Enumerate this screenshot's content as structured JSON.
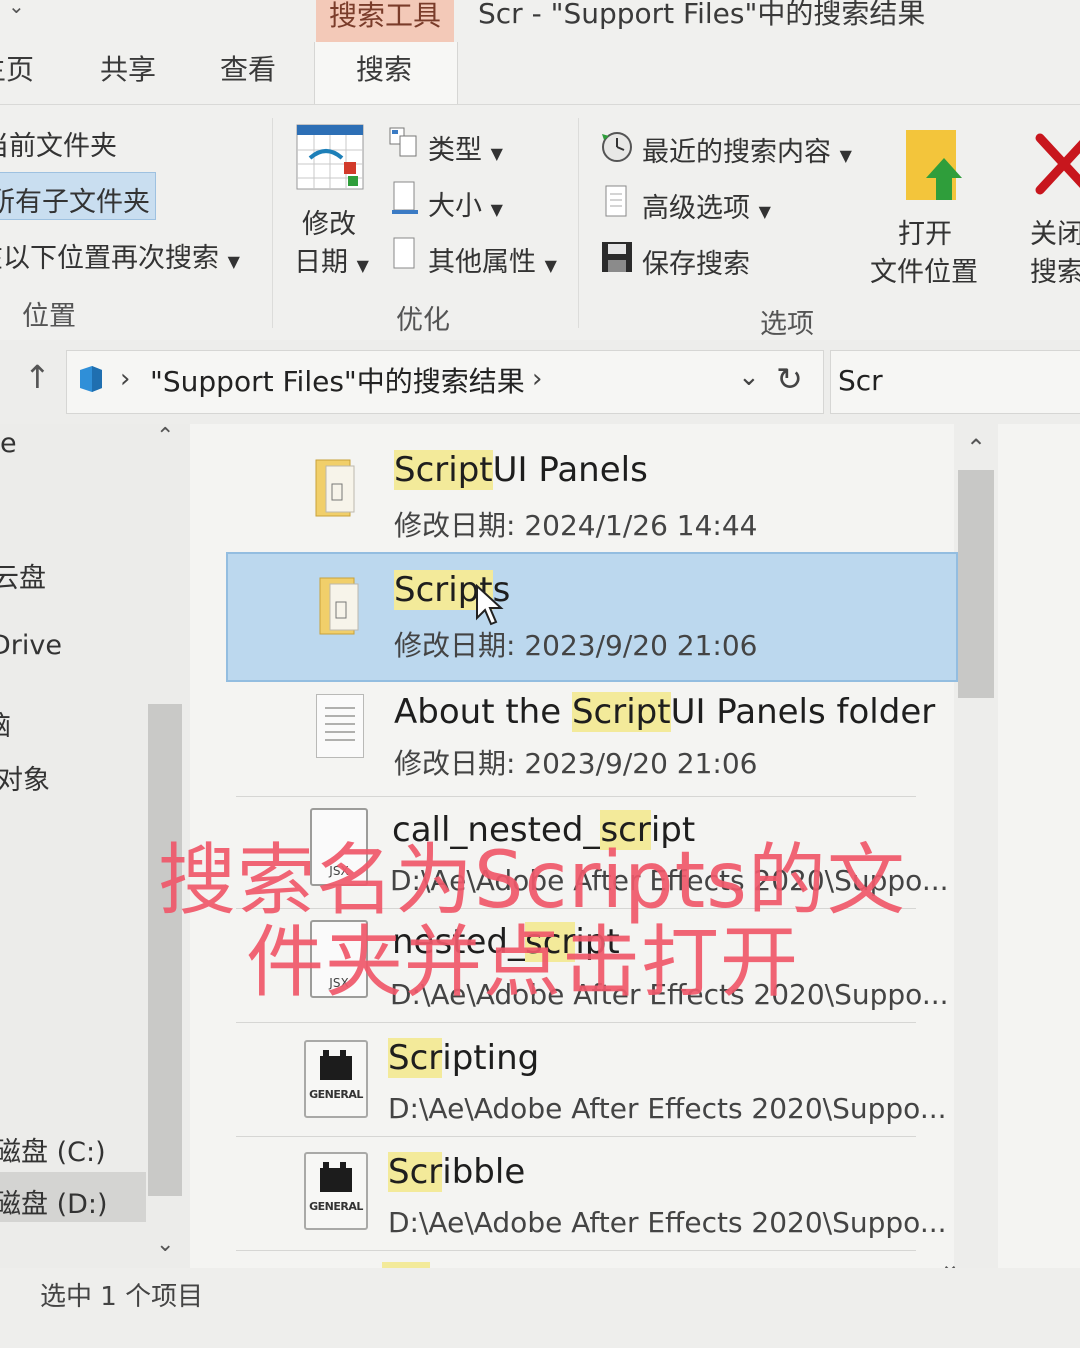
{
  "window": {
    "contextual_tab": "搜索工具",
    "title": "Scr - \"Support Files\"中的搜索结果"
  },
  "tabs": [
    "主页",
    "共享",
    "查看",
    "搜索"
  ],
  "ribbon": {
    "location": {
      "current_folder": "当前文件夹",
      "all_subfolders": "所有子文件夹",
      "search_again": "在以下位置再次搜索",
      "label": "位置"
    },
    "refine": {
      "date_modified_line1": "修改",
      "date_modified_line2": "日期",
      "kind": "类型",
      "size": "大小",
      "other_properties": "其他属性",
      "label": "优化"
    },
    "options": {
      "recent_searches": "最近的搜索内容",
      "advanced_options": "高级选项",
      "save_search": "保存搜索",
      "open_location_line1": "打开",
      "open_location_line2": "文件位置",
      "close_search_line1": "关闭",
      "close_search_line2": "搜索",
      "label": "选项"
    }
  },
  "address": {
    "path": "\"Support Files\"中的搜索结果",
    "search_query": "Scr"
  },
  "nav": {
    "items": [
      "e",
      "云盘",
      "Drive",
      "脑",
      "对象",
      "磁盘 (C:)",
      "磁盘 (D:)"
    ]
  },
  "results": [
    {
      "name_pre": "",
      "name_hl": "Script",
      "name_post": "UI Panels",
      "meta": "修改日期: 2024/1/26 14:44",
      "icon": "folder-icon"
    },
    {
      "name_pre": "",
      "name_hl": "Script",
      "name_post": "s",
      "meta": "修改日期: 2023/9/20 21:06",
      "icon": "folder-icon",
      "selected": true
    },
    {
      "name_pre": "About the ",
      "name_hl": "Script",
      "name_post": "UI Panels folder",
      "meta": "修改日期: 2023/9/20 21:06",
      "icon": "text-file-icon"
    },
    {
      "name_pre": "call_nested_",
      "name_hl": "scr",
      "name_post": "ipt",
      "meta": "D:\\Ae\\Adobe After Effects 2020\\Suppo...",
      "icon": "jsx-file-icon",
      "icon_label": "JSX"
    },
    {
      "name_pre": "nested_",
      "name_hl": "scr",
      "name_post": "ipt",
      "meta": "D:\\Ae\\Adobe After Effects 2020\\Suppo...",
      "icon": "jsx-file-icon",
      "icon_label": "JSX"
    },
    {
      "name_pre": "",
      "name_hl": "Scr",
      "name_post": "ipting",
      "meta": "D:\\Ae\\Adobe After Effects 2020\\Suppo...",
      "icon": "general-file-icon",
      "icon_label": "GENERAL"
    },
    {
      "name_pre": "",
      "name_hl": "Scr",
      "name_post": "ibble",
      "meta": "D:\\Ae\\Adobe After Effects 2020\\Suppo...",
      "icon": "general-file-icon",
      "icon_label": "GENERAL"
    }
  ],
  "overlay": {
    "line1": "搜索名为Scripts的文",
    "line2": "件夹并点击打开"
  },
  "status": {
    "selection": "选中 1 个项目"
  },
  "colors": {
    "selection_bg": "#bcd8ee",
    "highlight": "#f3ea9a",
    "overlay_text": "#f0586a",
    "contextual_tab": "#f3c9b8",
    "close_x": "#c8161d",
    "open_arrow": "#2f9e3b"
  }
}
